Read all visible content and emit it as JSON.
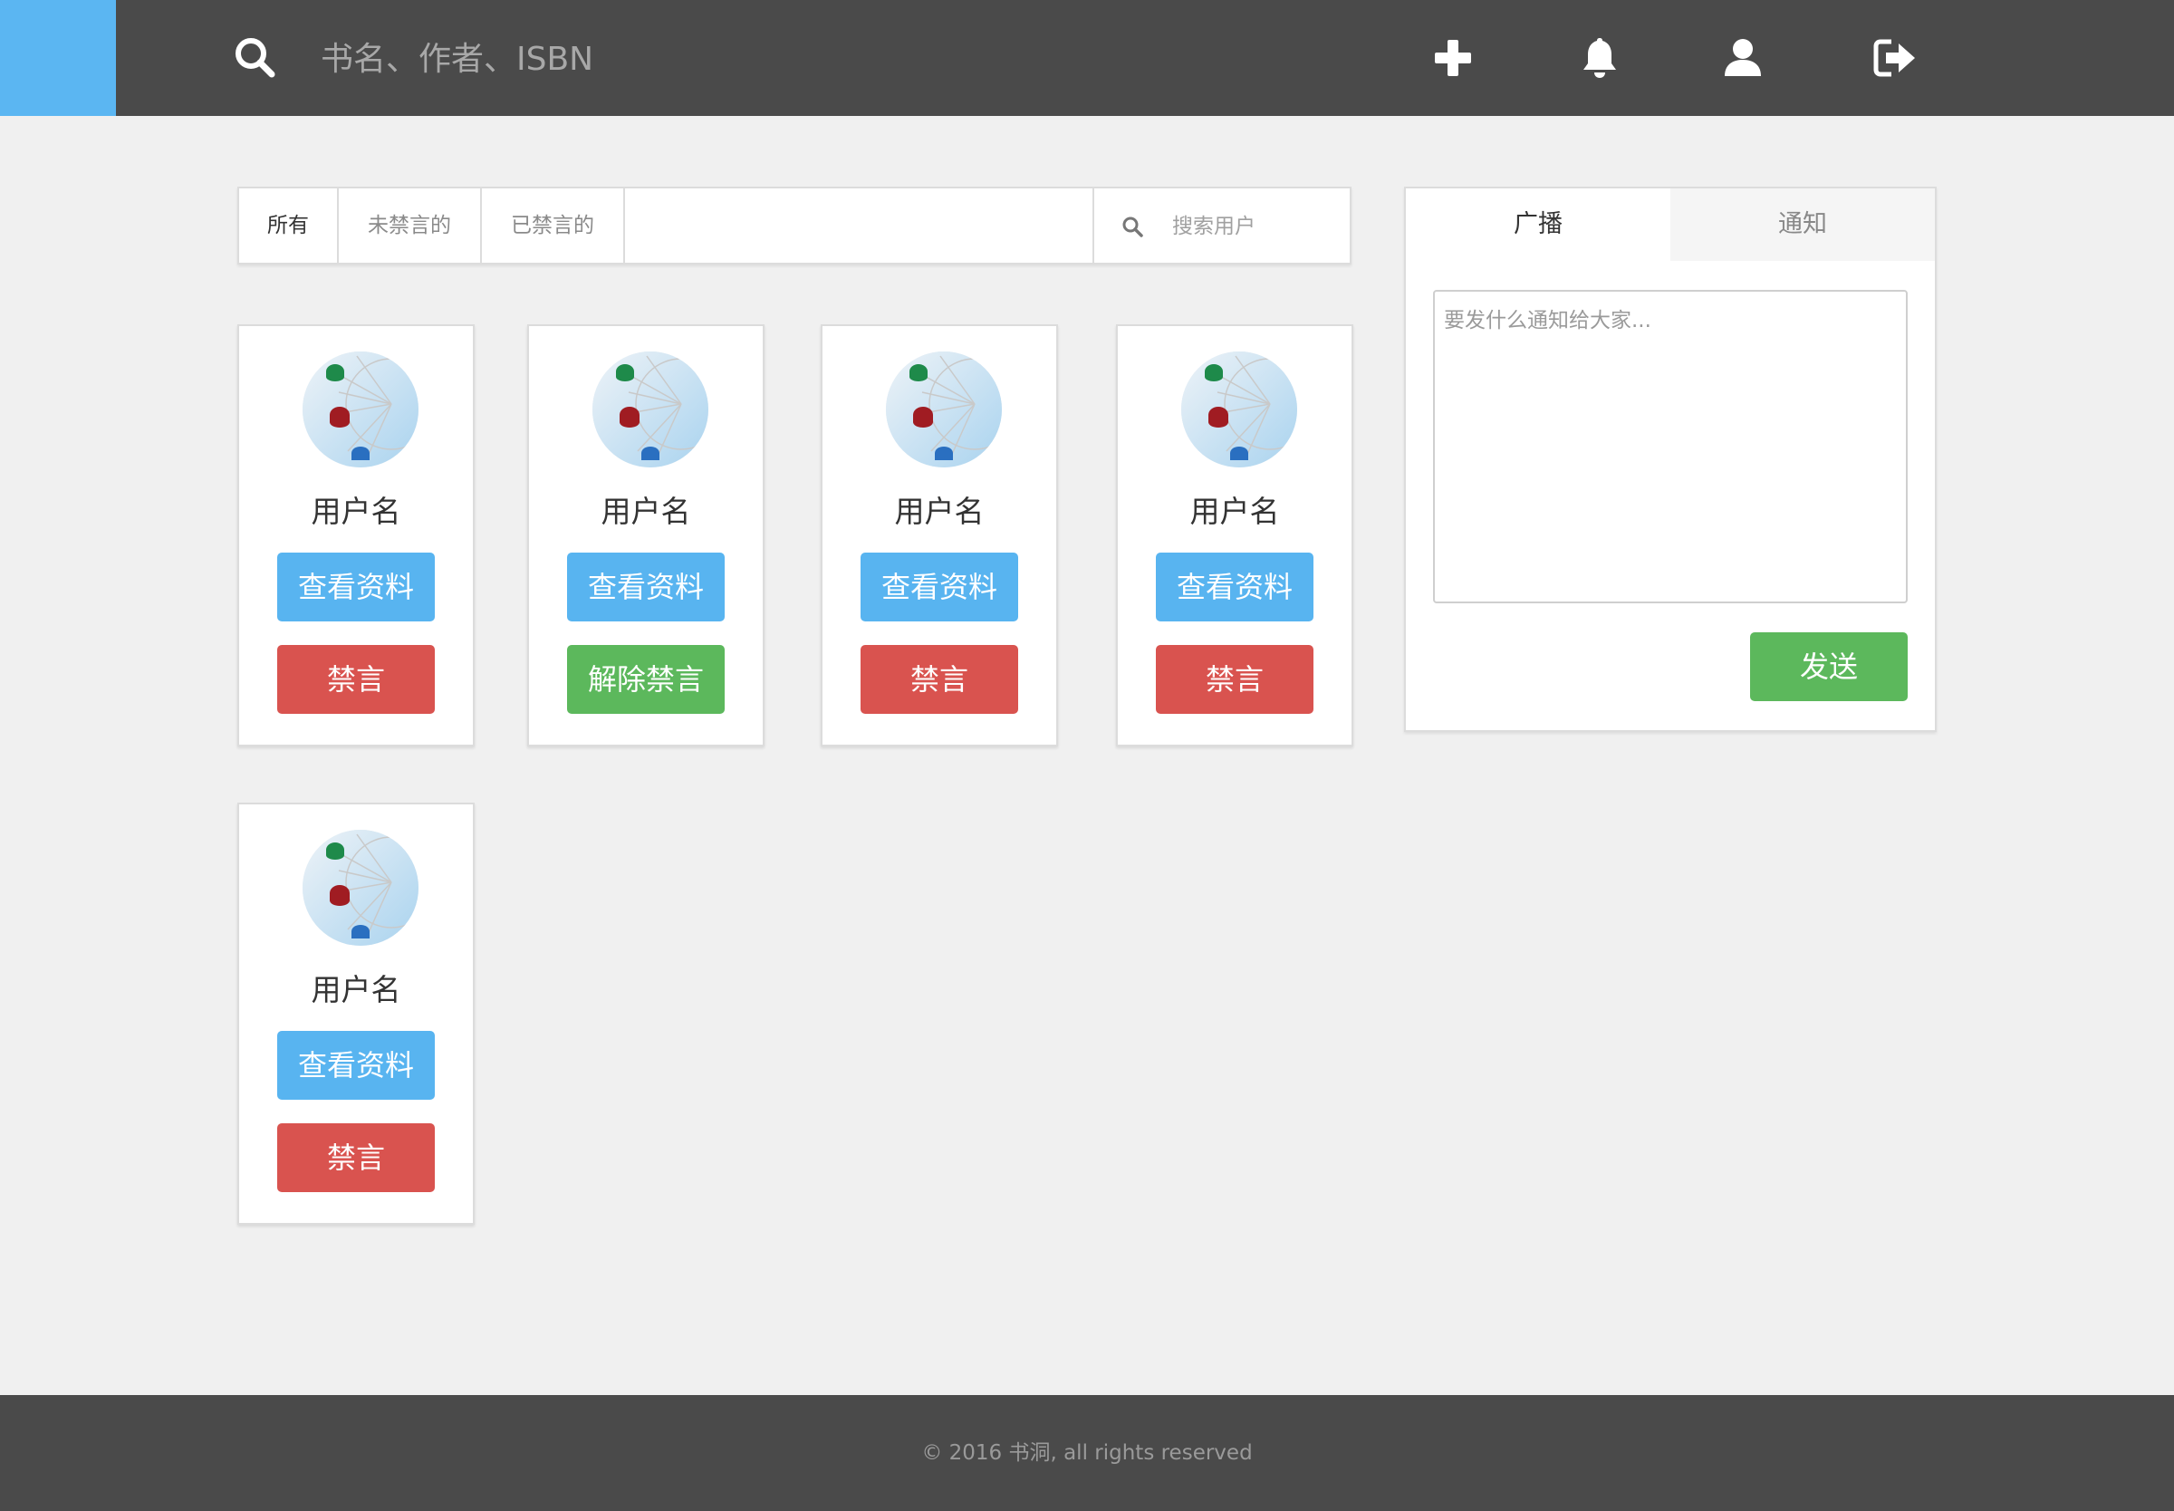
{
  "header": {
    "search_placeholder": "书名、作者、ISBN",
    "icons": [
      "search-icon",
      "plus-icon",
      "bell-icon",
      "user-icon",
      "logout-icon"
    ],
    "colors": {
      "bar": "#4a4a4a",
      "brand": "#5bb6f2"
    }
  },
  "filters": {
    "tabs": [
      {
        "label": "所有",
        "active": true
      },
      {
        "label": "未禁言的",
        "active": false
      },
      {
        "label": "已禁言的",
        "active": false
      }
    ],
    "search_placeholder": "搜索用户"
  },
  "users": [
    {
      "name": "用户名",
      "view_label": "查看资料",
      "action_label": "禁言",
      "action": "mute"
    },
    {
      "name": "用户名",
      "view_label": "查看资料",
      "action_label": "解除禁言",
      "action": "unmute"
    },
    {
      "name": "用户名",
      "view_label": "查看资料",
      "action_label": "禁言",
      "action": "mute"
    },
    {
      "name": "用户名",
      "view_label": "查看资料",
      "action_label": "禁言",
      "action": "mute"
    },
    {
      "name": "用户名",
      "view_label": "查看资料",
      "action_label": "禁言",
      "action": "mute"
    }
  ],
  "panel": {
    "tabs": [
      {
        "label": "广播",
        "active": true
      },
      {
        "label": "通知",
        "active": false
      }
    ],
    "textarea_placeholder": "要发什么通知给大家...",
    "send_label": "发送"
  },
  "footer": {
    "text": "© 2016 书洞, all rights reserved"
  },
  "colors": {
    "blue": "#58b4f0",
    "red": "#d9534f",
    "green": "#5cb85c"
  }
}
